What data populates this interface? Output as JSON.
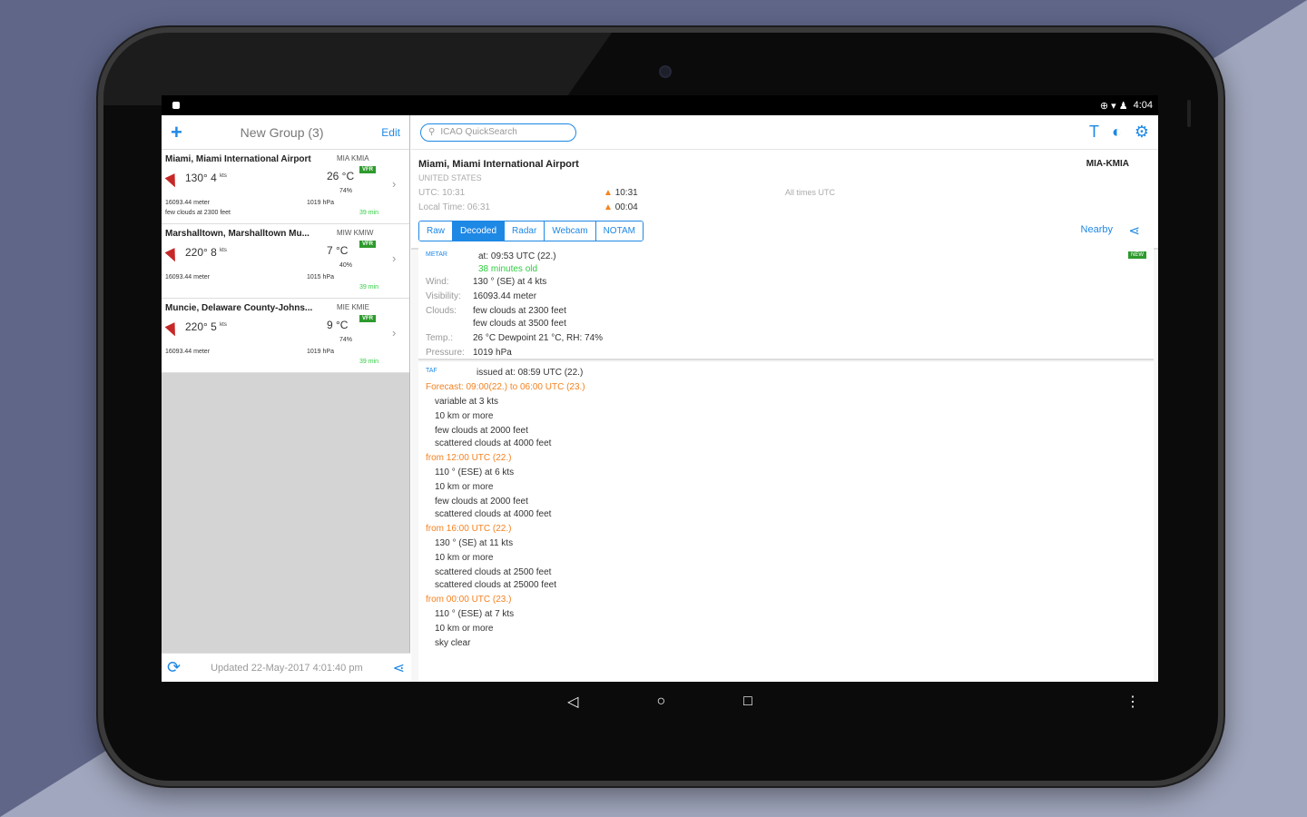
{
  "status": {
    "time": "4:04"
  },
  "left": {
    "plus": "+",
    "group_title": "New Group (3)",
    "edit": "Edit",
    "stations": [
      {
        "name": "Miami, Miami International Airport",
        "codes": "MIA  KMIA",
        "flight_rule": "VFR",
        "wind": "130° 4",
        "wind_unit": "kts",
        "temp": "26 °C",
        "humidity": "74%",
        "visibility": "16093.44 meter",
        "clouds": "few clouds at 2300 feet",
        "pressure": "1019 hPa",
        "age": "39 min"
      },
      {
        "name": "Marshalltown, Marshalltown Mu...",
        "codes": "MIW  KMIW",
        "flight_rule": "VFR",
        "wind": "220° 8",
        "wind_unit": "kts",
        "temp": "7 °C",
        "humidity": "40%",
        "visibility": "16093.44 meter",
        "clouds": "",
        "pressure": "1015 hPa",
        "age": "39 min"
      },
      {
        "name": "Muncie, Delaware County-Johns...",
        "codes": "MIE  KMIE",
        "flight_rule": "VFR",
        "wind": "220° 5",
        "wind_unit": "kts",
        "temp": "9 °C",
        "humidity": "74%",
        "visibility": "16093.44 meter",
        "clouds": "",
        "pressure": "1019 hPa",
        "age": "39 min"
      }
    ],
    "updated": "Updated 22-May-2017 4:01:40 pm"
  },
  "right": {
    "search_placeholder": "ICAO QuickSearch",
    "airport_name": "Miami, Miami International Airport",
    "country": "UNITED STATES",
    "code": "MIA-KMIA",
    "utc": "UTC: 10:31",
    "local_time": "Local Time: 06:31",
    "sunrise": "10:31",
    "sunset": "00:04",
    "all_times": "All times UTC",
    "tabs": [
      "Raw",
      "Decoded",
      "Radar",
      "Webcam",
      "NOTAM"
    ],
    "nearby": "Nearby",
    "metar": {
      "label": "METAR",
      "badge": "NEW",
      "at": "at: 09:53 UTC (22.)",
      "age": "38 minutes old",
      "wind_label": "Wind:",
      "wind": "130 ° (SE) at 4 kts",
      "visibility_label": "Visibility:",
      "visibility": "16093.44 meter",
      "clouds_label": "Clouds:",
      "clouds1": "few clouds at 2300 feet",
      "clouds2": "few clouds at 3500 feet",
      "temp_label": "Temp.:",
      "temp": "26 °C Dewpoint 21 °C, RH: 74%",
      "pressure_label": "Pressure:",
      "pressure": "1019 hPa"
    },
    "taf": {
      "label": "TAF",
      "issued": "issued at: 08:59 UTC (22.)",
      "forecast": "Forecast: 09:00(22.) to 06:00 UTC (23.)",
      "f1": [
        "variable at 3 kts",
        "10 km or more",
        "few clouds at 2000 feet",
        "scattered clouds at 4000 feet"
      ],
      "from1": "from 12:00 UTC (22.)",
      "f2": [
        "110 ° (ESE) at 6 kts",
        "10 km or more",
        "few clouds at 2000 feet",
        "scattered clouds at 4000 feet"
      ],
      "from2": "from 16:00 UTC (22.)",
      "f3": [
        "130 ° (SE) at 11 kts",
        "10 km or more",
        "scattered clouds at 2500 feet",
        "scattered clouds at 25000 feet"
      ],
      "from3": "from 00:00 UTC (23.)",
      "f4": [
        "110 ° (ESE) at 7 kts",
        "10 km or more",
        "sky clear"
      ]
    }
  },
  "nav": {
    "back": "◁",
    "home": "○",
    "recents": "□",
    "more": "⋮"
  }
}
